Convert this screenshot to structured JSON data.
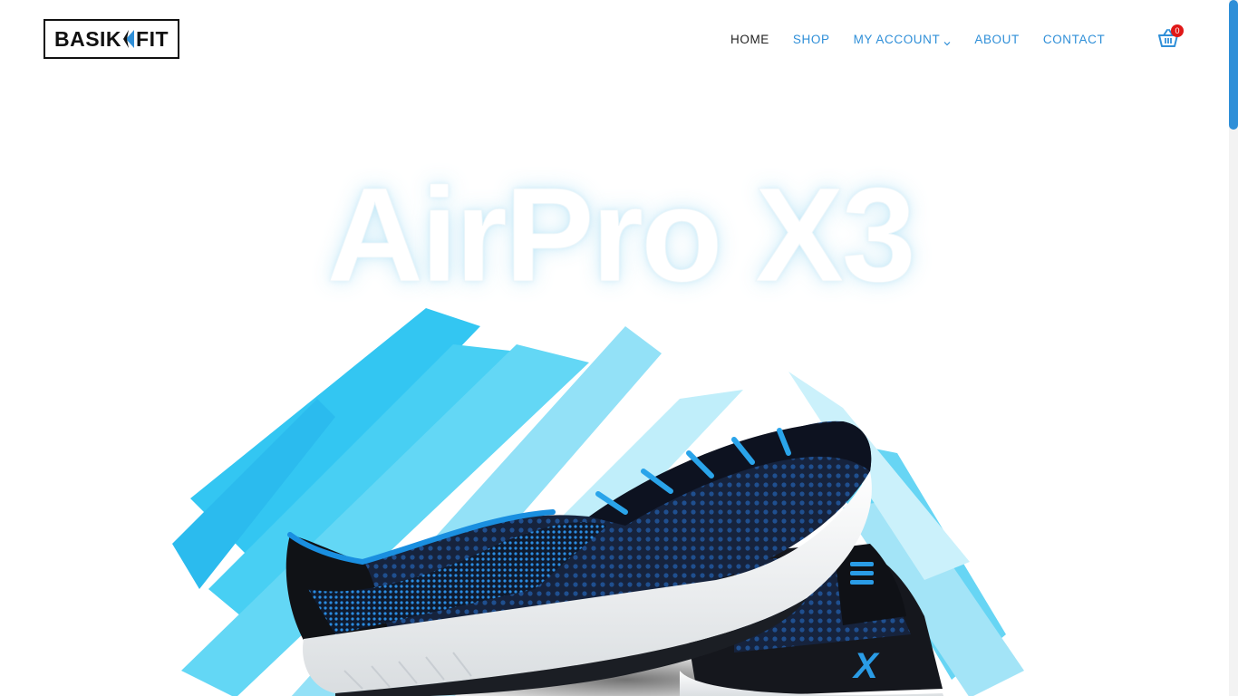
{
  "brand": {
    "name_left": "BASIK",
    "name_right": "FIT"
  },
  "nav": {
    "items": [
      {
        "label": "HOME",
        "active": true
      },
      {
        "label": "SHOP",
        "active": false
      },
      {
        "label": "MY ACCOUNT",
        "active": false,
        "has_dropdown": true
      },
      {
        "label": "ABOUT",
        "active": false
      },
      {
        "label": "CONTACT",
        "active": false
      }
    ]
  },
  "cart": {
    "count": "0",
    "icon": "basket-icon"
  },
  "hero": {
    "title": "AirPro X3",
    "image": "running-shoes-image",
    "shoe_logo": "X"
  },
  "colors": {
    "accent": "#2f8fd8",
    "badge": "#e01818",
    "splash": "#27c2f0",
    "shoe_dark": "#141a28",
    "shoe_blue": "#1d7fd6"
  }
}
